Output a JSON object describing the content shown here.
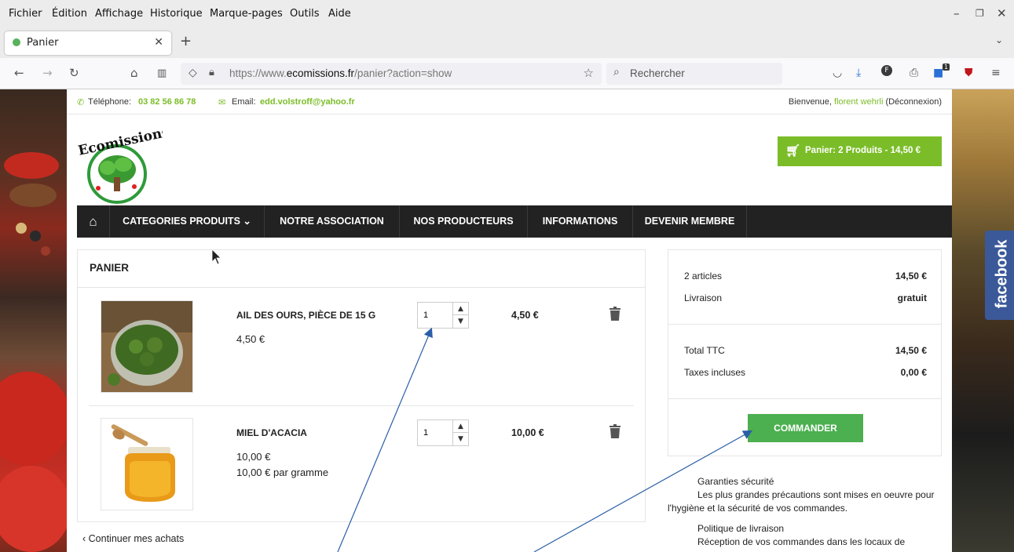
{
  "browser": {
    "menu": [
      "Fichier",
      "Édition",
      "Affichage",
      "Historique",
      "Marque-pages",
      "Outils",
      "Aide"
    ],
    "tab_title": "Panier",
    "url_prefix": "https://www.",
    "url_domain": "ecomissions.fr",
    "url_path": "/panier?action=show",
    "search_placeholder": "Rechercher",
    "badge_count": "1"
  },
  "topbar": {
    "phone_label": "Téléphone:",
    "phone": "03 82 56 86 78",
    "email_label": "Email:",
    "email": "edd.volstroff@yahoo.fr",
    "welcome": "Bienvenue,",
    "user": "florent wehrli",
    "logout": "(Déconnexion)"
  },
  "header": {
    "logo_text": "Ecomissions",
    "cart_button": "Panier: 2 Produits - 14,50 €"
  },
  "nav": {
    "items": [
      "CATEGORIES PRODUITS ⌄",
      "NOTRE ASSOCIATION",
      "NOS PRODUCTEURS",
      "INFORMATIONS",
      "DEVENIR MEMBRE"
    ]
  },
  "cart": {
    "title": "PANIER",
    "items": [
      {
        "name": "AIL DES OURS, PIÈCE DE 15 G",
        "price": "4,50 €",
        "unit": "",
        "qty": "1",
        "total": "4,50 €"
      },
      {
        "name": "MIEL D'ACACIA",
        "price": "10,00 €",
        "unit": "10,00 € par gramme",
        "qty": "1",
        "total": "10,00 €"
      }
    ],
    "continue": "Continuer mes achats"
  },
  "summary": {
    "articles_label": "2 articles",
    "articles_value": "14,50 €",
    "shipping_label": "Livraison",
    "shipping_value": "gratuit",
    "total_label": "Total TTC",
    "total_value": "14,50 €",
    "taxes_label": "Taxes incluses",
    "taxes_value": "0,00 €",
    "order_button": "COMMANDER"
  },
  "reassurance": {
    "security_title": "Garanties sécurité",
    "security_text": "Les plus grandes précautions sont mises en oeuvre pour l'hygiène et la sécurité de vos commandes.",
    "delivery_title": "Politique de livraison",
    "delivery_text": "Réception de vos commandes dans les locaux de"
  },
  "social": {
    "facebook": "facebook"
  },
  "colors": {
    "brand_green": "#7bbd28",
    "order_green": "#4caf50",
    "nav_dark": "#222222",
    "facebook_blue": "#3b5998"
  }
}
